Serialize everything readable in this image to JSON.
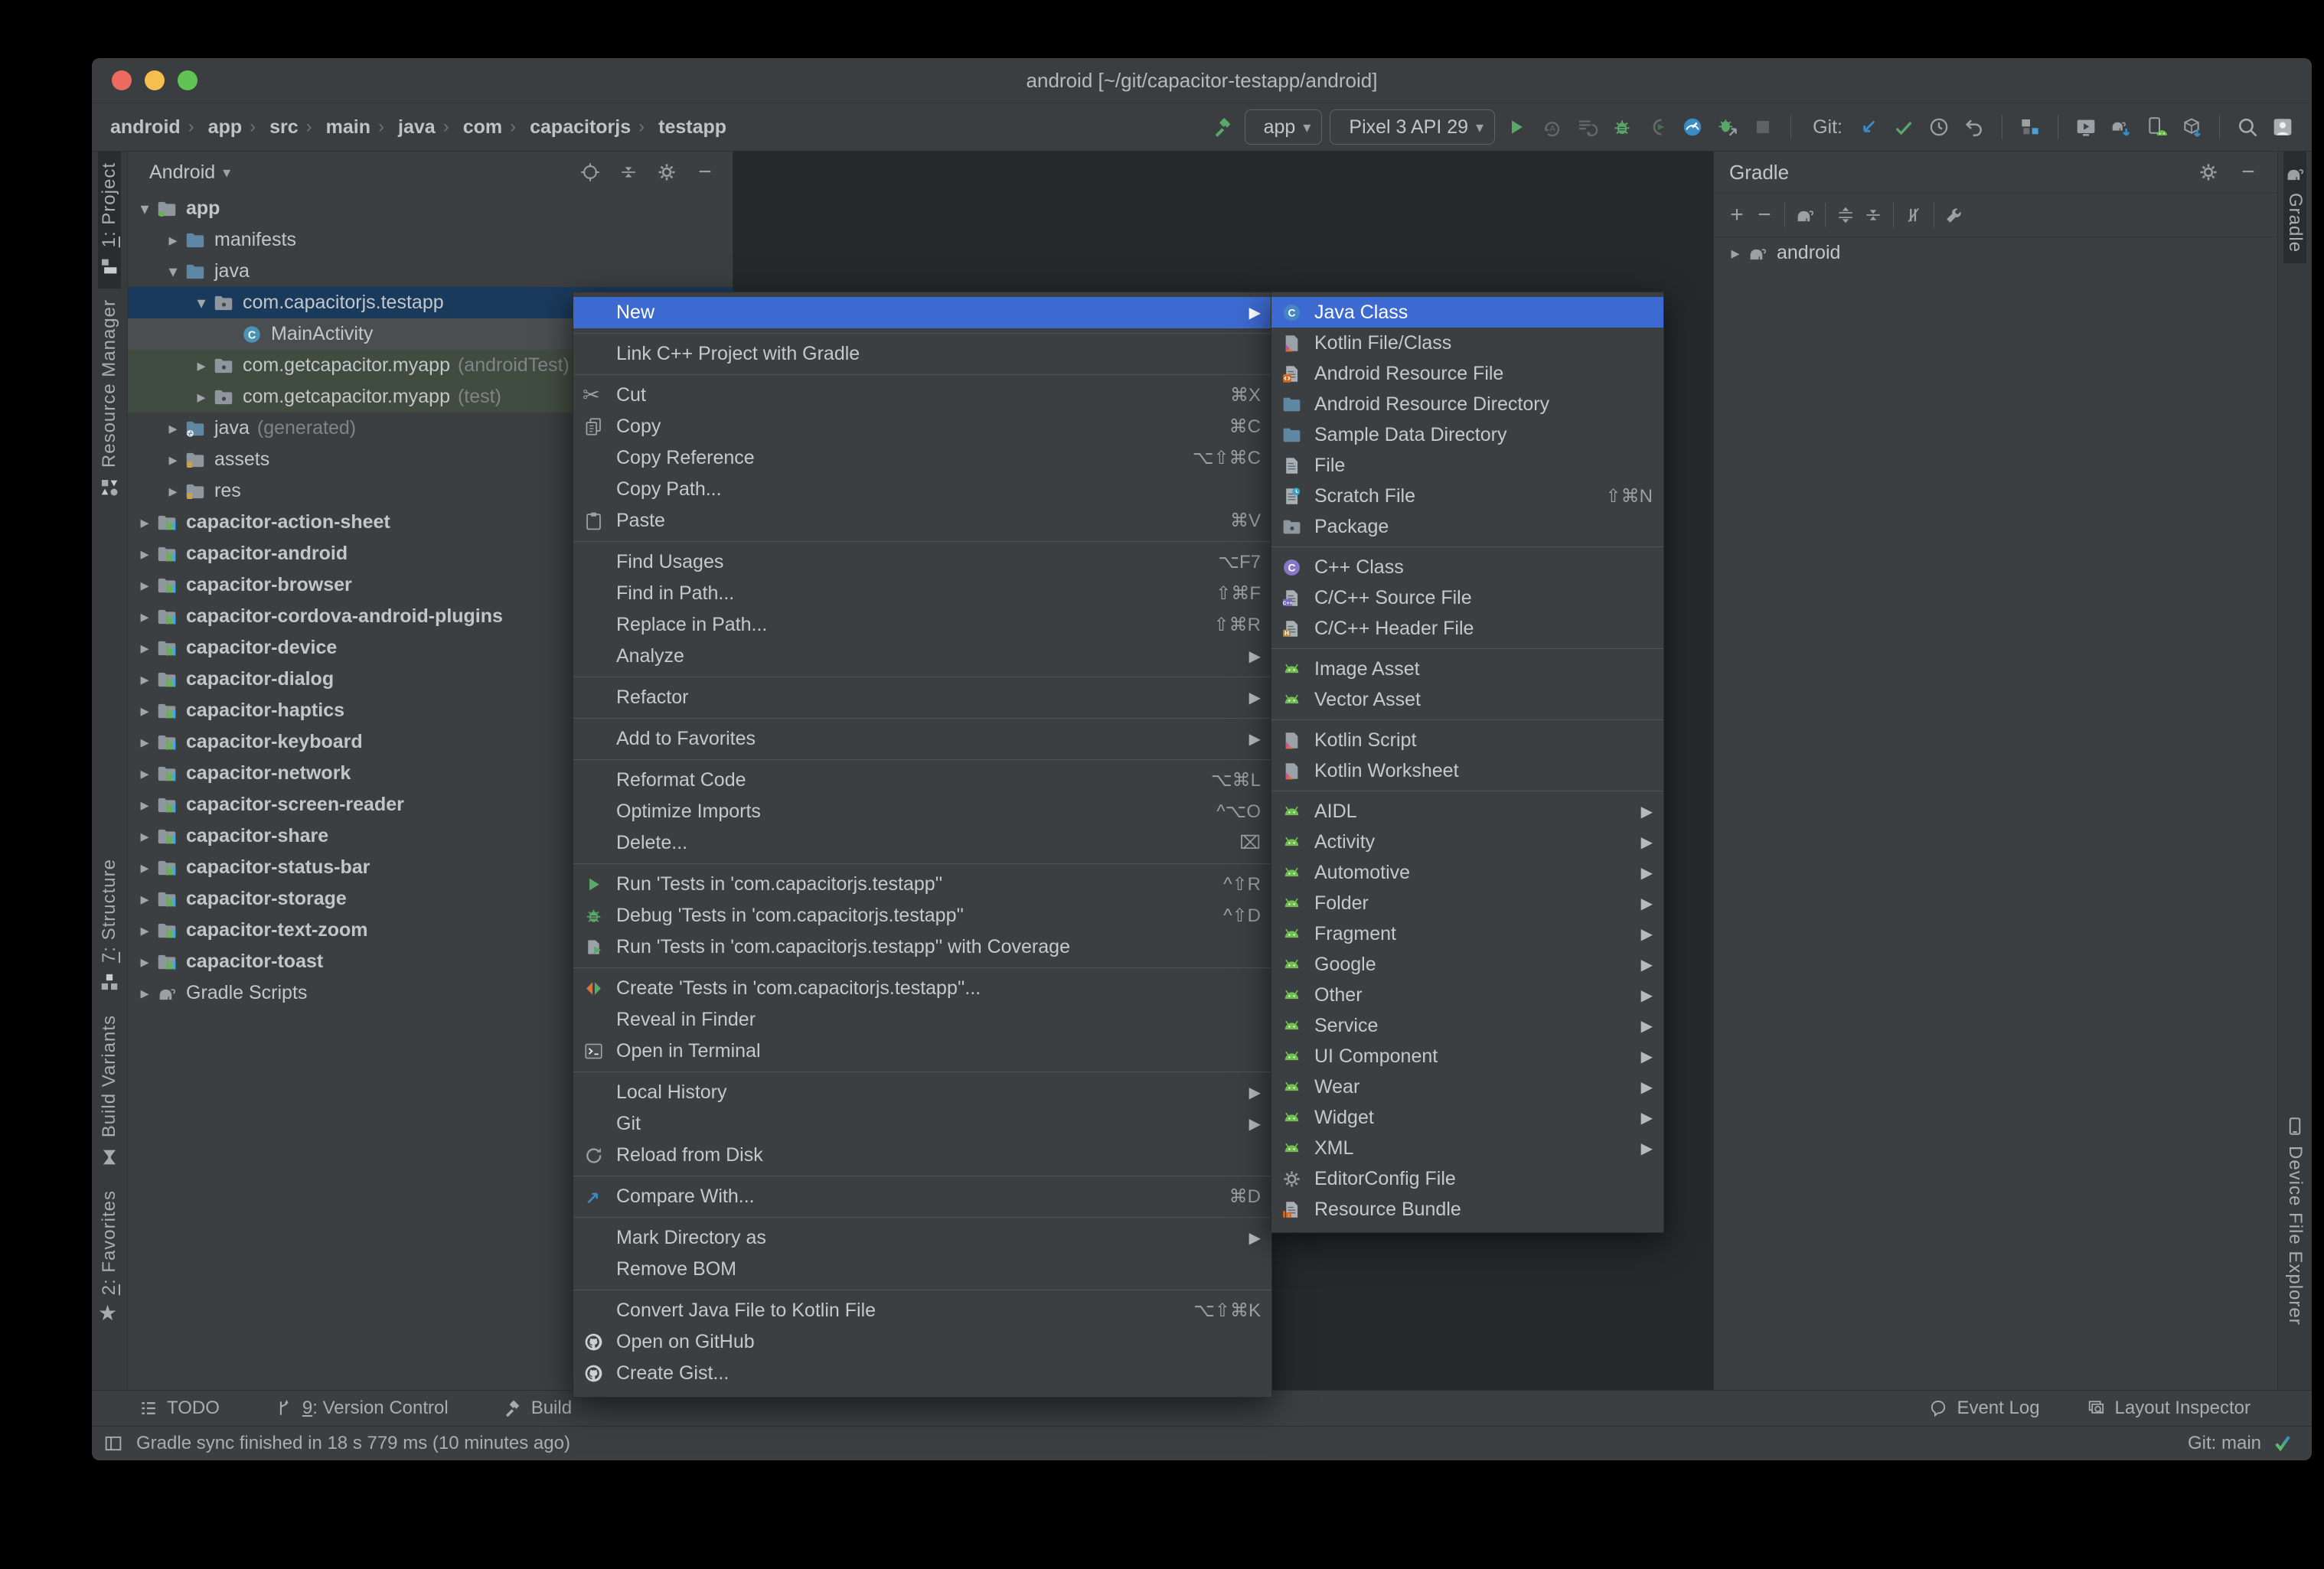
{
  "colors": {
    "accent": "#3d6ad1",
    "run_green": "#59a869",
    "android_green": "#6fbf4e",
    "link_blue": "#3b8cc6",
    "selected_row": "#1a3a5c",
    "test_row_green": "#414c41"
  },
  "window": {
    "title": "android [~/git/capacitor-testapp/android]"
  },
  "toolbar": {
    "breadcrumbs": [
      {
        "label": "android",
        "icon": "folder-android"
      },
      {
        "label": "app",
        "icon": "folder-app"
      },
      {
        "label": "src",
        "icon": "folder-steel"
      },
      {
        "label": "main",
        "icon": "folder-steel"
      },
      {
        "label": "java",
        "icon": "folder-java"
      },
      {
        "label": "com",
        "icon": "package"
      },
      {
        "label": "capacitorjs",
        "icon": "package"
      },
      {
        "label": "testapp",
        "icon": "package"
      }
    ],
    "run_config": {
      "label": "app",
      "icon": "android"
    },
    "device": {
      "label": "Pixel 3 API 29",
      "icon": "phone"
    },
    "git_label": "Git:",
    "run_icons": [
      "hammer-green"
    ],
    "exec_icons": [
      "run",
      "apply-a",
      "rerun-list",
      "debug",
      "attach",
      "gauge",
      "bug-arrow",
      "stop"
    ],
    "git_icons": [
      "arrow-dl",
      "check",
      "clock",
      "undo"
    ],
    "tool_icons": [
      "structure-icon",
      "avd",
      "elephant-sync",
      "sdk",
      "box-down"
    ],
    "end_icons": [
      "search",
      "avatar"
    ]
  },
  "project_panel": {
    "selector": "Android",
    "header_icons": [
      "locate",
      "collapse-all",
      "gear",
      "minus-glyph"
    ],
    "tree": [
      {
        "label": "app",
        "icon": "folder-app",
        "arrow": "down",
        "level": 0,
        "bold": true
      },
      {
        "label": "manifests",
        "icon": "folder-steel",
        "arrow": "right",
        "level": 1
      },
      {
        "label": "java",
        "icon": "folder-steel",
        "arrow": "down",
        "level": 1
      },
      {
        "label": "com.capacitorjs.testapp",
        "icon": "package",
        "arrow": "down",
        "level": 2,
        "row": "rsel"
      },
      {
        "label": "MainActivity",
        "icon": "class-main",
        "arrow": "none",
        "level": 3,
        "row": "rgray"
      },
      {
        "label": "com.getcapacitor.myapp",
        "suffix": "(androidTest)",
        "icon": "package",
        "arrow": "right",
        "level": 2,
        "row": "rgreen"
      },
      {
        "label": "com.getcapacitor.myapp",
        "suffix": "(test)",
        "icon": "package",
        "arrow": "right",
        "level": 2,
        "row": "rgreen"
      },
      {
        "label": "java",
        "suffix": "(generated)",
        "icon": "folder-gen",
        "arrow": "right",
        "level": 1
      },
      {
        "label": "assets",
        "icon": "folder-assets",
        "arrow": "right",
        "level": 1
      },
      {
        "label": "res",
        "icon": "folder-assets",
        "arrow": "right",
        "level": 1
      },
      {
        "label": "capacitor-action-sheet",
        "icon": "module",
        "arrow": "right",
        "level": 0,
        "bold": true
      },
      {
        "label": "capacitor-android",
        "icon": "module",
        "arrow": "right",
        "level": 0,
        "bold": true
      },
      {
        "label": "capacitor-browser",
        "icon": "module",
        "arrow": "right",
        "level": 0,
        "bold": true
      },
      {
        "label": "capacitor-cordova-android-plugins",
        "icon": "module",
        "arrow": "right",
        "level": 0,
        "bold": true
      },
      {
        "label": "capacitor-device",
        "icon": "module",
        "arrow": "right",
        "level": 0,
        "bold": true
      },
      {
        "label": "capacitor-dialog",
        "icon": "module",
        "arrow": "right",
        "level": 0,
        "bold": true
      },
      {
        "label": "capacitor-haptics",
        "icon": "module",
        "arrow": "right",
        "level": 0,
        "bold": true
      },
      {
        "label": "capacitor-keyboard",
        "icon": "module",
        "arrow": "right",
        "level": 0,
        "bold": true
      },
      {
        "label": "capacitor-network",
        "icon": "module",
        "arrow": "right",
        "level": 0,
        "bold": true
      },
      {
        "label": "capacitor-screen-reader",
        "icon": "module",
        "arrow": "right",
        "level": 0,
        "bold": true
      },
      {
        "label": "capacitor-share",
        "icon": "module",
        "arrow": "right",
        "level": 0,
        "bold": true
      },
      {
        "label": "capacitor-status-bar",
        "icon": "module",
        "arrow": "right",
        "level": 0,
        "bold": true
      },
      {
        "label": "capacitor-storage",
        "icon": "module",
        "arrow": "right",
        "level": 0,
        "bold": true
      },
      {
        "label": "capacitor-text-zoom",
        "icon": "module",
        "arrow": "right",
        "level": 0,
        "bold": true
      },
      {
        "label": "capacitor-toast",
        "icon": "module",
        "arrow": "right",
        "level": 0,
        "bold": true
      },
      {
        "label": "Gradle Scripts",
        "icon": "elephant",
        "arrow": "right",
        "level": 0
      }
    ]
  },
  "context_menu": {
    "sections": [
      [
        {
          "label": "New",
          "arrow": true,
          "selected": true
        }
      ],
      [
        {
          "label": "Link C++ Project with Gradle"
        }
      ],
      [
        {
          "label": "Cut",
          "icon": "scissors",
          "shortcut": "⌘X"
        },
        {
          "label": "Copy",
          "icon": "copy",
          "shortcut": "⌘C"
        },
        {
          "label": "Copy Reference",
          "shortcut": "⌥⇧⌘C"
        },
        {
          "label": "Copy Path..."
        },
        {
          "label": "Paste",
          "icon": "paste",
          "shortcut": "⌘V"
        }
      ],
      [
        {
          "label": "Find Usages",
          "shortcut": "⌥F7"
        },
        {
          "label": "Find in Path...",
          "shortcut": "⇧⌘F"
        },
        {
          "label": "Replace in Path...",
          "shortcut": "⇧⌘R"
        },
        {
          "label": "Analyze",
          "arrow": true
        }
      ],
      [
        {
          "label": "Refactor",
          "arrow": true
        }
      ],
      [
        {
          "label": "Add to Favorites",
          "arrow": true
        }
      ],
      [
        {
          "label": "Reformat Code",
          "shortcut": "⌥⌘L"
        },
        {
          "label": "Optimize Imports",
          "shortcut": "^⌥O"
        },
        {
          "label": "Delete...",
          "shortcut": "⌧"
        }
      ],
      [
        {
          "label": "Run 'Tests in 'com.capacitorjs.testapp''",
          "icon": "run",
          "shortcut": "^⇧R"
        },
        {
          "label": "Debug 'Tests in 'com.capacitorjs.testapp''",
          "icon": "debug",
          "shortcut": "^⇧D"
        },
        {
          "label": "Run 'Tests in 'com.capacitorjs.testapp'' with Coverage",
          "icon": "coverage"
        }
      ],
      [
        {
          "label": "Create 'Tests in 'com.capacitorjs.testapp''...",
          "icon": "create-tests"
        },
        {
          "label": "Reveal in Finder"
        },
        {
          "label": "Open in Terminal",
          "icon": "terminal"
        }
      ],
      [
        {
          "label": "Local History",
          "arrow": true
        },
        {
          "label": "Git",
          "arrow": true
        },
        {
          "label": "Reload from Disk",
          "icon": "reload"
        }
      ],
      [
        {
          "label": "Compare With...",
          "icon": "compare",
          "shortcut": "⌘D"
        }
      ],
      [
        {
          "label": "Mark Directory as",
          "arrow": true
        },
        {
          "label": "Remove BOM"
        }
      ],
      [
        {
          "label": "Convert Java File to Kotlin File",
          "shortcut": "⌥⇧⌘K"
        },
        {
          "label": "Open on GitHub",
          "icon": "github"
        },
        {
          "label": "Create Gist...",
          "icon": "github"
        }
      ]
    ]
  },
  "new_submenu": {
    "sections": [
      [
        {
          "label": "Java Class",
          "icon": "class-java",
          "selected": true
        },
        {
          "label": "Kotlin File/Class",
          "icon": "kotlin"
        },
        {
          "label": "Android Resource File",
          "icon": "android-file"
        },
        {
          "label": "Android Resource Directory",
          "icon": "folder-steel"
        },
        {
          "label": "Sample Data Directory",
          "icon": "folder-steel"
        },
        {
          "label": "File",
          "icon": "file"
        },
        {
          "label": "Scratch File",
          "icon": "scratch",
          "shortcut": "⇧⌘N"
        },
        {
          "label": "Package",
          "icon": "package"
        }
      ],
      [
        {
          "label": "C++ Class",
          "icon": "cpp-class"
        },
        {
          "label": "C/C++ Source File",
          "icon": "cpp-source"
        },
        {
          "label": "C/C++ Header File",
          "icon": "cpp-header"
        }
      ],
      [
        {
          "label": "Image Asset",
          "icon": "android"
        },
        {
          "label": "Vector Asset",
          "icon": "android"
        }
      ],
      [
        {
          "label": "Kotlin Script",
          "icon": "kotlin"
        },
        {
          "label": "Kotlin Worksheet",
          "icon": "kotlin"
        }
      ],
      [
        {
          "label": "AIDL",
          "icon": "android",
          "arrow": true
        },
        {
          "label": "Activity",
          "icon": "android",
          "arrow": true
        },
        {
          "label": "Automotive",
          "icon": "android",
          "arrow": true
        },
        {
          "label": "Folder",
          "icon": "android",
          "arrow": true
        },
        {
          "label": "Fragment",
          "icon": "android",
          "arrow": true
        },
        {
          "label": "Google",
          "icon": "android",
          "arrow": true
        },
        {
          "label": "Other",
          "icon": "android",
          "arrow": true
        },
        {
          "label": "Service",
          "icon": "android",
          "arrow": true
        },
        {
          "label": "UI Component",
          "icon": "android",
          "arrow": true
        },
        {
          "label": "Wear",
          "icon": "android",
          "arrow": true
        },
        {
          "label": "Widget",
          "icon": "android",
          "arrow": true
        },
        {
          "label": "XML",
          "icon": "android",
          "arrow": true
        },
        {
          "label": "EditorConfig File",
          "icon": "gear"
        },
        {
          "label": "Resource Bundle",
          "icon": "bundle"
        }
      ]
    ]
  },
  "gradle_panel": {
    "title": "Gradle",
    "header_icons": [
      "gear",
      "minus-glyph"
    ],
    "toolbar_icons": [
      "plus-glyph",
      "minus-glyph",
      "div",
      "elephant",
      "div",
      "expand-all",
      "collapse-all",
      "div",
      "offline",
      "div",
      "wrench"
    ],
    "tree": [
      {
        "label": "android",
        "icon": "elephant",
        "arrow": "right"
      }
    ]
  },
  "left_stripe": {
    "top": [
      {
        "label": "1: Project",
        "mnemonic": "1",
        "icon": "project-ic",
        "active": true
      },
      {
        "label": "Resource Manager",
        "icon": "resource-ic"
      }
    ],
    "bottom": [
      {
        "label": "7: Structure",
        "mnemonic": "7",
        "icon": "structure-tab"
      },
      {
        "label": "Build Variants",
        "icon": "build-variants-ic"
      },
      {
        "label": "2: Favorites",
        "mnemonic": "2",
        "icon": "star"
      }
    ]
  },
  "right_stripe": {
    "top": [
      {
        "label": "Gradle",
        "icon": "elephant",
        "active": true
      }
    ],
    "bottom": [
      {
        "label": "Device File Explorer",
        "icon": "device-explorer-ic"
      }
    ]
  },
  "toolwindow_bar": {
    "left": [
      {
        "label": "TODO",
        "icon": "todo"
      },
      {
        "label": "9: Version Control",
        "mnemonic": "9",
        "icon": "vcs"
      },
      {
        "label": "Build",
        "icon": "hammer-gray"
      }
    ],
    "right": [
      {
        "label": "Event Log",
        "icon": "balloon"
      },
      {
        "label": "Layout Inspector",
        "icon": "layout-inspector"
      }
    ]
  },
  "status_bar": {
    "message": "Gradle sync finished in 18 s 779 ms (10 minutes ago)",
    "git_branch": "Git: main"
  }
}
